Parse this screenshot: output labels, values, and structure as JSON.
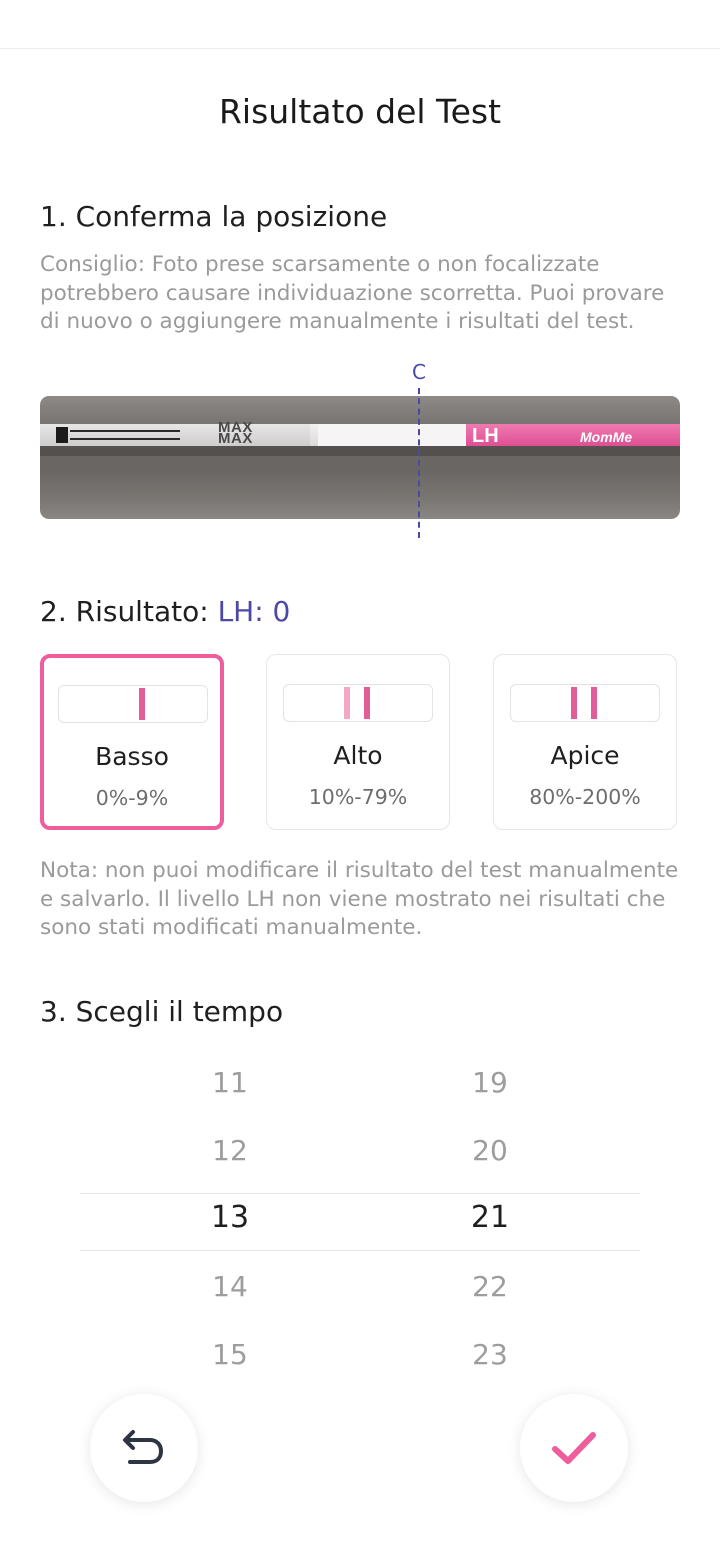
{
  "header": {
    "title": "Risultato del Test"
  },
  "step1": {
    "title": "1. Conferma la posizione",
    "hint": "Consiglio: Foto prese scarsamente o non focalizzate potrebbero causare individuazione scorretta. Puoi provare di nuovo o aggiungere manualmente i risultati del test.",
    "control_line_label": "C",
    "strip_text_max": "MAX",
    "strip_text_lh": "LH",
    "strip_text_brand": "MomMe"
  },
  "step2": {
    "title_prefix": "2. Risultato:",
    "title_value": "LH: 0",
    "options": [
      {
        "label": "Basso",
        "range": "0%-9%",
        "selected": true
      },
      {
        "label": "Alto",
        "range": "10%-79%",
        "selected": false
      },
      {
        "label": "Apice",
        "range": "80%-200%",
        "selected": false
      }
    ],
    "note": "Nota: non puoi modificare il risultato del test manualmente e salvarlo. Il livello LH non viene mostrato nei risultati che sono stati modificati manualmente."
  },
  "step3": {
    "title": "3. Scegli il tempo",
    "hours": [
      "11",
      "12",
      "13",
      "14",
      "15"
    ],
    "minutes": [
      "19",
      "20",
      "21",
      "22",
      "23"
    ],
    "selected_hour": "13",
    "selected_minute": "21"
  },
  "colors": {
    "accent": "#4c48a6",
    "pink": "#ef5d9c",
    "pink_light": "#f3a7c9"
  },
  "icons": {
    "back": "undo-arrow-icon",
    "confirm": "checkmark-icon"
  }
}
